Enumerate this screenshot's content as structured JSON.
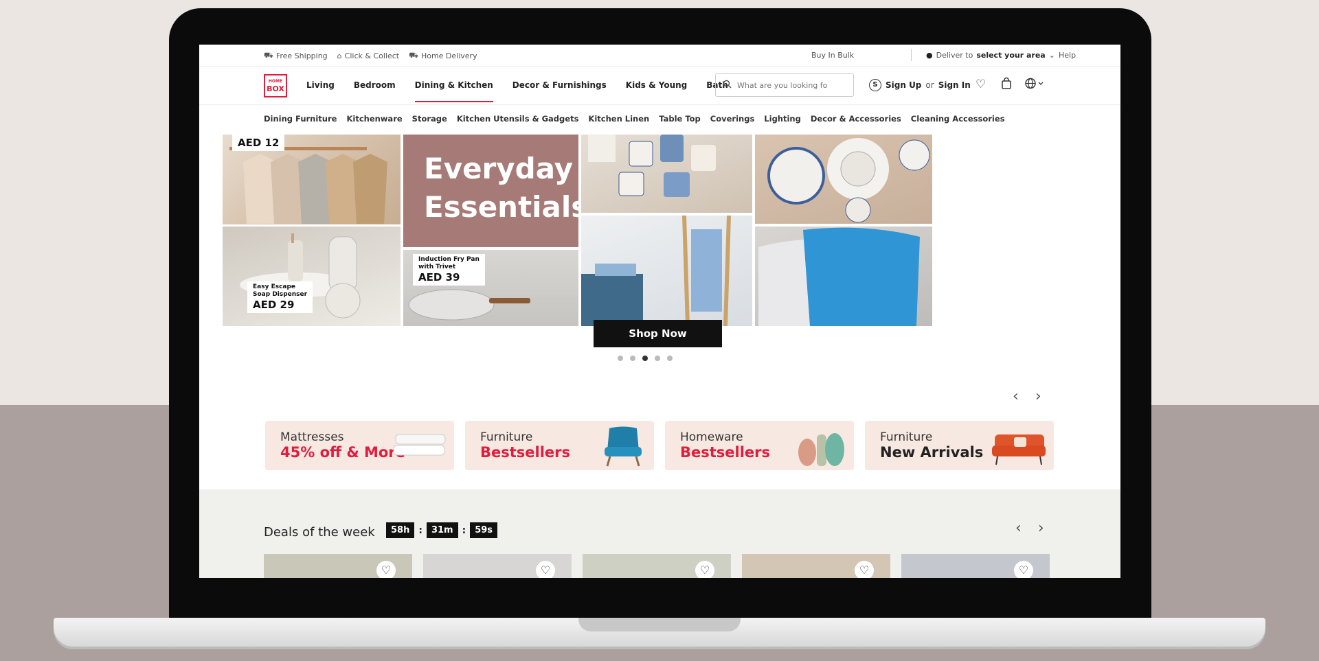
{
  "utility": {
    "free_shipping": "Free Shipping",
    "click_collect": "Click & Collect",
    "home_delivery": "Home Delivery",
    "buy_in_bulk": "Buy In Bulk",
    "deliver_to": "Deliver to",
    "select_area": "select your area",
    "help": "Help"
  },
  "logo": {
    "line1": "HOME",
    "line2": "BOX"
  },
  "nav": {
    "items": [
      "Living",
      "Bedroom",
      "Dining & Kitchen",
      "Decor & Furnishings",
      "Kids & Young",
      "Bath"
    ],
    "active": "Dining & Kitchen"
  },
  "search": {
    "placeholder": "What are you looking fo"
  },
  "account": {
    "signup": "Sign Up",
    "or": "or",
    "signin": "Sign In"
  },
  "subnav": [
    "Dining Furniture",
    "Kitchenware",
    "Storage",
    "Kitchen Utensils & Gadgets",
    "Kitchen Linen",
    "Table Top",
    "Coverings",
    "Lighting",
    "Decor & Accessories",
    "Cleaning Accessories"
  ],
  "hero": {
    "hangers_price": "AED 12",
    "headline_line1": "Everyday",
    "headline_line2": "Essentials",
    "soap_name1": "Easy Escape",
    "soap_name2": "Soap Dispenser",
    "soap_price": "AED 29",
    "pan_name1": "Induction Fry Pan",
    "pan_name2": "with Trivet",
    "pan_price": "AED 39",
    "cta": "Shop Now"
  },
  "promos": [
    {
      "line1": "Mattresses",
      "line2": "45% off & More"
    },
    {
      "line1": "Furniture",
      "line2": "Bestsellers"
    },
    {
      "line1": "Homeware",
      "line2": "Bestsellers"
    },
    {
      "line1": "Furniture",
      "line2": "New Arrivals"
    }
  ],
  "deals": {
    "title": "Deals of the week",
    "hours": "58h",
    "minutes": "31m",
    "seconds": "59s"
  },
  "colors": {
    "brand": "#e01d3c",
    "hero_panel": "#a57a77",
    "promo_bg": "#f7e9e2"
  }
}
